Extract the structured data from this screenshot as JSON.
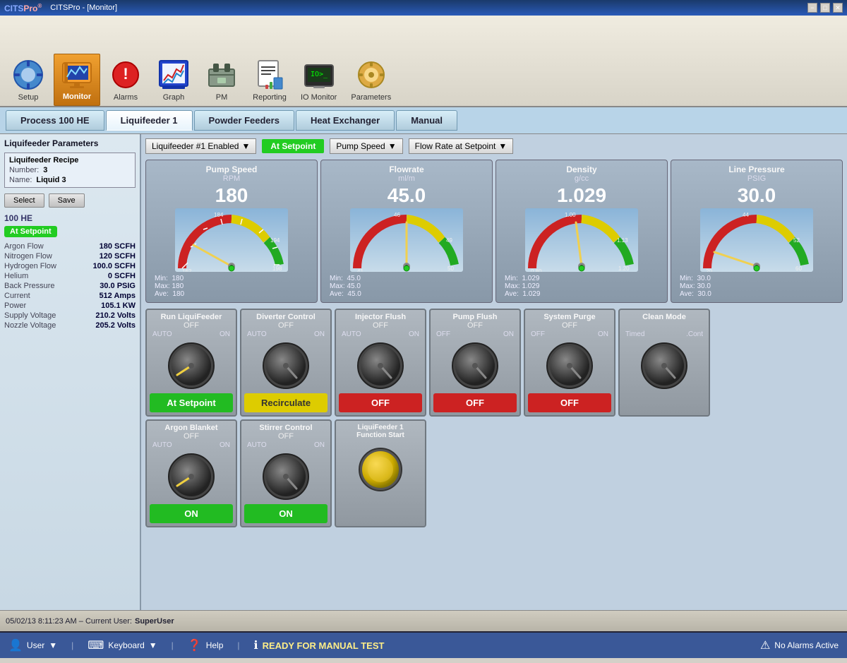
{
  "titlebar": {
    "title": "CITSPro  - [Monitor]",
    "minimize": "−",
    "maximize": "□",
    "close": "✕"
  },
  "toolbar": {
    "items": [
      {
        "id": "setup",
        "label": "Setup",
        "icon": "⚙",
        "active": false
      },
      {
        "id": "monitor",
        "label": "Monitor",
        "icon": "📊",
        "active": true
      },
      {
        "id": "alarms",
        "label": "Alarms",
        "icon": "🔔",
        "active": false
      },
      {
        "id": "graph",
        "label": "Graph",
        "icon": "📈",
        "active": false
      },
      {
        "id": "pm",
        "label": "PM",
        "icon": "🔧",
        "active": false
      },
      {
        "id": "reporting",
        "label": "Reporting",
        "icon": "📋",
        "active": false
      },
      {
        "id": "io_monitor",
        "label": "IO Monitor",
        "icon": "🖥",
        "active": false
      },
      {
        "id": "parameters",
        "label": "Parameters",
        "icon": "⚙",
        "active": false
      }
    ]
  },
  "tabs": [
    {
      "id": "process",
      "label": "Process 100 HE",
      "active": false
    },
    {
      "id": "liquifeeder1",
      "label": "Liquifeeder 1",
      "active": true
    },
    {
      "id": "powder_feeders",
      "label": "Powder Feeders",
      "active": false
    },
    {
      "id": "heat_exchanger",
      "label": "Heat Exchanger",
      "active": false
    },
    {
      "id": "manual",
      "label": "Manual",
      "active": false
    }
  ],
  "left_panel": {
    "title": "Liquifeeder Parameters",
    "recipe": {
      "title": "Liquifeeder Recipe",
      "number_label": "Number:",
      "number_value": "3",
      "name_label": "Name:",
      "name_value": "Liquid 3"
    },
    "select_btn": "Select",
    "save_btn": "Save",
    "section": "100 HE",
    "status": "At Setpoint",
    "params": [
      {
        "label": "Argon Flow",
        "value": "180 SCFH"
      },
      {
        "label": "Nitrogen Flow",
        "value": "120 SCFH"
      },
      {
        "label": "Hydrogen Flow",
        "value": "100.0 SCFH"
      },
      {
        "label": "Helium",
        "value": "0 SCFH"
      },
      {
        "label": "Back Pressure",
        "value": "30.0 PSIG"
      },
      {
        "label": "Current",
        "value": "512 Amps"
      },
      {
        "label": "Power",
        "value": "105.1 KW"
      },
      {
        "label": "Supply Voltage",
        "value": "210.2 Volts"
      },
      {
        "label": "Nozzle Voltage",
        "value": "205.2 Volts"
      }
    ]
  },
  "right_panel": {
    "dropdowns": {
      "feeder": "Liquifeeder #1 Enabled",
      "status": "At Setpoint",
      "pump_speed": "Pump Speed",
      "flow_rate": "Flow Rate at Setpoint"
    },
    "gauges": [
      {
        "id": "pump_speed",
        "title": "Pump Speed",
        "unit": "RPM",
        "value": "180",
        "min": 160,
        "max": 200,
        "current": 180,
        "needle_angle": -20,
        "stats": {
          "min": "180",
          "max": "180",
          "ave": "180"
        }
      },
      {
        "id": "flowrate",
        "title": "Flowrate",
        "unit": "ml/m",
        "value": "45.0",
        "min": 41,
        "max": 50,
        "current": 45,
        "needle_angle": 0,
        "stats": {
          "min": "45.0",
          "max": "45.0",
          "ave": "45.0"
        }
      },
      {
        "id": "density",
        "title": "Density",
        "unit": "g/cc",
        "value": "1.029",
        "min": 0.8,
        "max": 1.2,
        "current": 1.029,
        "needle_angle": -5,
        "stats": {
          "min": "1.029",
          "max": "1.029",
          "ave": "1.029"
        }
      },
      {
        "id": "line_pressure",
        "title": "Line Pressure",
        "unit": "PSIG",
        "value": "30.0",
        "min": 20,
        "max": 60,
        "current": 30,
        "needle_angle": -45,
        "stats": {
          "min": "30.0",
          "max": "30.0",
          "ave": "30.0"
        }
      }
    ],
    "controls": {
      "row1": [
        {
          "id": "run_liquifeeder",
          "title": "Run LiquiFeeder",
          "state": "OFF",
          "mode": "AUTO_ON",
          "knob_angle": -45,
          "status_label": "At Setpoint",
          "status_color": "green"
        },
        {
          "id": "diverter_control",
          "title": "Diverter Control",
          "state": "OFF",
          "mode": "AUTO_ON",
          "knob_angle": 0,
          "status_label": "Recirculate",
          "status_color": "yellow"
        },
        {
          "id": "injector_flush",
          "title": "Injector Flush",
          "state": "OFF",
          "mode": "AUTO_ON",
          "knob_angle": 0,
          "status_label": "OFF",
          "status_color": "red"
        },
        {
          "id": "pump_flush",
          "title": "Pump Flush",
          "state": "OFF",
          "mode": "OFF_ON",
          "knob_angle": 0,
          "status_label": "OFF",
          "status_color": "red"
        },
        {
          "id": "system_purge",
          "title": "System Purge",
          "state": "OFF",
          "mode": "OFF_ON",
          "knob_angle": 0,
          "status_label": "OFF",
          "status_color": "red"
        },
        {
          "id": "clean_mode",
          "title": "Clean Mode",
          "state": "",
          "mode": "TIMED_CONT",
          "knob_angle": 0,
          "status_label": "",
          "status_color": "none"
        }
      ],
      "row2": [
        {
          "id": "argon_blanket",
          "title": "Argon Blanket",
          "state": "OFF",
          "mode": "AUTO_ON",
          "knob_angle": -45,
          "status_label": "ON",
          "status_color": "green"
        },
        {
          "id": "stirrer_control",
          "title": "Stirrer Control",
          "state": "OFF",
          "mode": "AUTO_ON",
          "knob_angle": 0,
          "status_label": "ON",
          "status_color": "green"
        },
        {
          "id": "liquifeeder_start",
          "title": "LiquiFeeder 1 Function Start",
          "state": "",
          "mode": "BUTTON",
          "knob_angle": 0,
          "status_label": "",
          "status_color": "yellow_btn"
        }
      ]
    }
  },
  "status_bar": {
    "datetime": "05/02/13  8:11:23 AM",
    "user_label": "Current User:",
    "user": "SuperUser"
  },
  "footer": {
    "user_label": "User",
    "keyboard_label": "Keyboard",
    "help_label": "Help",
    "ready_text": "READY FOR MANUAL TEST",
    "alarms_text": "No Alarms Active"
  }
}
